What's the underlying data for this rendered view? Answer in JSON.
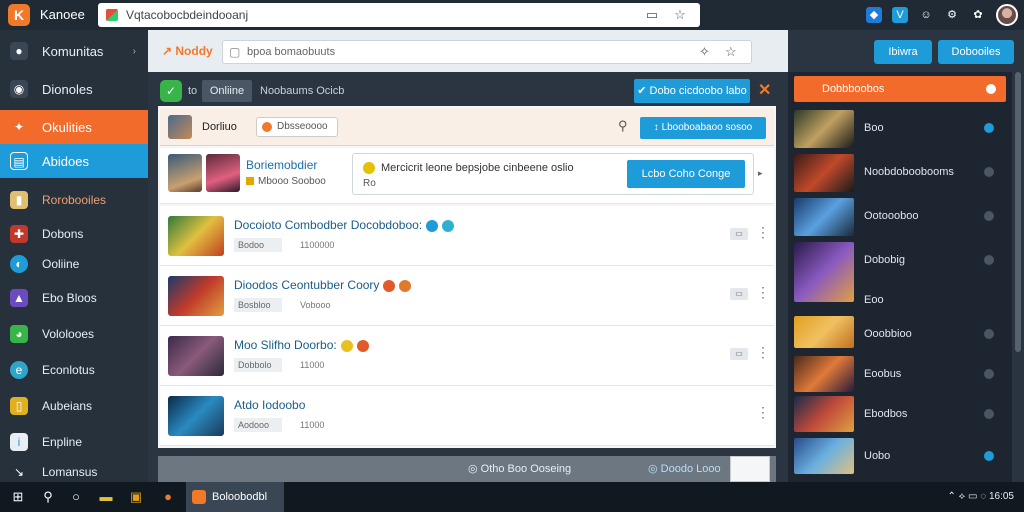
{
  "window": {
    "app_logo": "K",
    "app_title": "Kanoee",
    "url": "Vqtacobocbdeindooanj",
    "toolbar_icons": [
      "shield-icon",
      "v-icon",
      "face-icon",
      "gear-icon",
      "paw-icon"
    ]
  },
  "colors": {
    "accent_orange": "#f26b2b",
    "accent_blue": "#1e9bd9",
    "sidebar_bg": "#26313c",
    "success_green": "#38b549"
  },
  "sidebar": {
    "items": [
      {
        "label": "Komunitas",
        "icon": "steam-icon",
        "arrow": "›"
      },
      {
        "label": "Dionoles",
        "icon": "chat-icon"
      },
      {
        "label": "Okulities",
        "icon": "person-icon"
      },
      {
        "label": "Abidoes",
        "icon": "grid-icon"
      },
      {
        "label": "Rorobooiles",
        "icon": "folder-icon"
      },
      {
        "label": "Dobons",
        "icon": "puzzle-icon"
      },
      {
        "label": "Ooliine",
        "icon": "globe-icon"
      },
      {
        "label": "Ebo Bloos",
        "icon": "image-icon"
      },
      {
        "label": "Vololooes",
        "icon": "palette-icon"
      },
      {
        "label": "Econlotus",
        "icon": "edge-icon"
      },
      {
        "label": "Aubeians",
        "icon": "document-icon"
      },
      {
        "label": "Enpline",
        "icon": "info-icon"
      },
      {
        "label": "Lomansus",
        "icon": "arrow-icon"
      }
    ]
  },
  "header": {
    "brand": "Noddy",
    "search_placeholder": "bpoa bomaobuuts",
    "buttons": [
      "Ibiwra",
      "Dobooiles"
    ]
  },
  "panel": {
    "status_label": "to",
    "tab": "Onliine",
    "title": "Noobaums Ocicb",
    "cta": "Dobo cicdoobo labo",
    "profile": {
      "name": "Dorliuo",
      "pill": "Dbsseoooo",
      "button": "Lbooboabaoo sosoo"
    },
    "featured": {
      "title": "Boriemobdier",
      "sub": "Mbooo Sooboo",
      "notice_text": "Mercicrit leone bepsjobe cinbeene oslio",
      "notice_sub": "Ro",
      "notice_button": "Lcbo Coho Conge"
    },
    "rows": [
      {
        "title": "Docoioto Combodber Docobdoboo:",
        "tag": "Bodoo",
        "num": "1100000"
      },
      {
        "title": "Dioodos Ceontubber Coory",
        "tag": "Bosbloo",
        "num": "Vobooo"
      },
      {
        "title": "Moo Slifho Doorbo:",
        "tag": "Dobbolo",
        "num": "11000"
      },
      {
        "title": "Atdo Iodoobo",
        "tag": "Aodooo",
        "num": "11000"
      }
    ],
    "footer_text": "Otho Boo Ooseing",
    "footer_text2": "Doodo Looo"
  },
  "right_panel": {
    "head": "Dobbboobos",
    "items": [
      "Boo",
      "Noobdoboobooms",
      "Ootoooboo",
      "Dobobig",
      "Eoo",
      "Ooobbioo",
      "Eoobus",
      "Ebodbos",
      "Uobo"
    ]
  },
  "taskbar": {
    "active_app": "Boloobodbl",
    "tray": "16:05"
  }
}
